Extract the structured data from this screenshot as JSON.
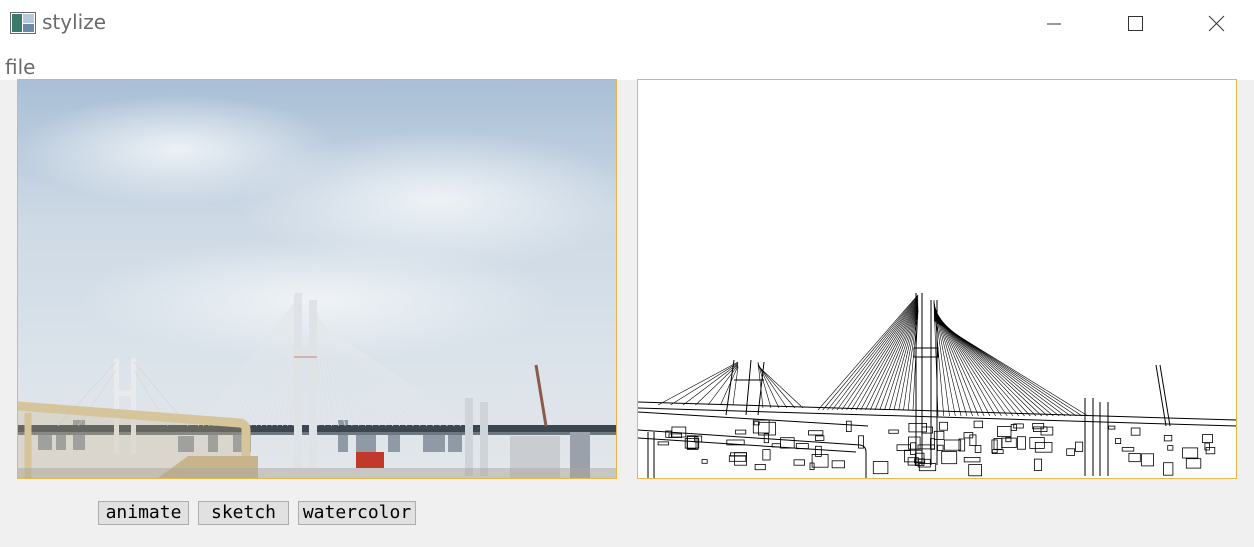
{
  "window": {
    "title": "stylize",
    "controls": {
      "minimize": "minimize-icon",
      "maximize": "maximize-icon",
      "close": "close-icon"
    }
  },
  "menu": {
    "file_label": "file"
  },
  "panels": {
    "original": {
      "content": "photo of a cable-stayed bridge under a cloudy sky"
    },
    "stylized": {
      "content": "edge-detected line drawing of the same bridge scene"
    }
  },
  "buttons": {
    "animate_label": "animate",
    "sketch_label": "sketch",
    "watercolor_label": "watercolor"
  },
  "colors": {
    "panel_border": "#e8b84a",
    "window_bg": "#f0f0f0",
    "button_bg": "#e1e1e1"
  }
}
